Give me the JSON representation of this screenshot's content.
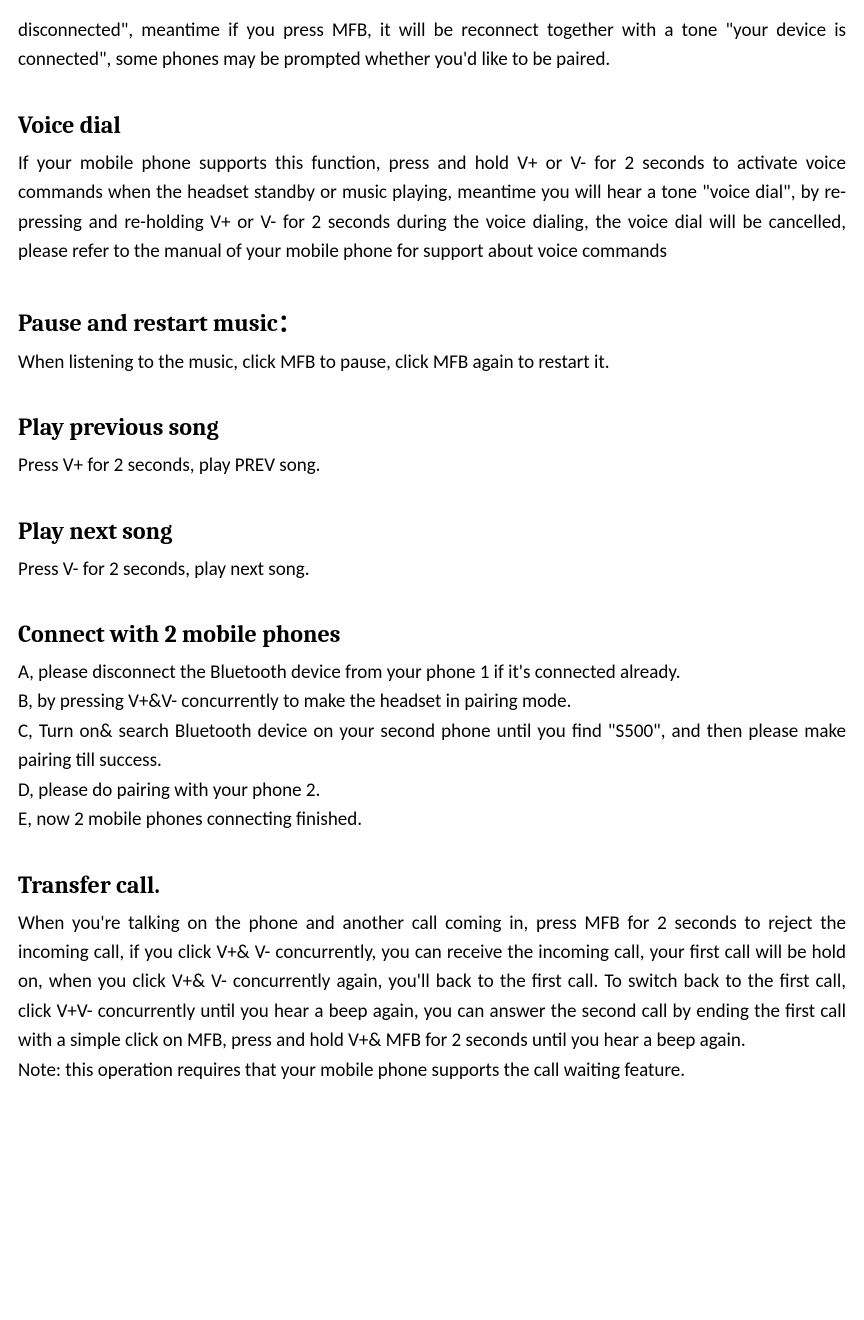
{
  "intro_para": "disconnected\", meantime if you press MFB, it will be reconnect together with a tone \"your device is connected\", some phones may be prompted whether you'd like to be paired.",
  "sections": {
    "voice_dial": {
      "heading": "Voice dial",
      "body": "If your mobile phone supports this function, press and hold V+ or V- for 2 seconds to activate voice commands when the headset standby or music playing, meantime you will hear a tone \"voice dial\", by re-pressing and re-holding V+ or V- for 2 seconds during the voice dialing, the voice dial will be cancelled, please refer to the manual of your mobile phone for support about voice commands"
    },
    "pause_restart": {
      "heading": "Pause and restart music：",
      "body": "When listening to the music, click MFB to pause, click MFB again to restart it."
    },
    "prev_song": {
      "heading": "Play previous song",
      "body": "Press V+ for 2 seconds, play PREV song."
    },
    "next_song": {
      "heading": "Play next song",
      "body": "Press V- for 2 seconds, play next song."
    },
    "connect_two": {
      "heading": "Connect with 2 mobile phones",
      "items": [
        "A, please disconnect the Bluetooth device from your phone 1 if it's connected already.",
        "B, by pressing V+&V- concurrently to make the headset in pairing mode.",
        "C, Turn on& search Bluetooth device on your second phone until you find \"S500\", and then please make pairing till success.",
        "D, please do pairing with your phone 2.",
        "E, now 2 mobile phones connecting finished."
      ]
    },
    "transfer_call": {
      "heading": "Transfer call.",
      "body": "When you're talking on the phone and another call coming in, press MFB for 2 seconds to reject the incoming call, if you click V+& V- concurrently, you can receive the incoming call, your first call will be hold on, when you click V+& V- concurrently again, you'll back to the first call. To switch back to the first call, click V+V- concurrently until you hear a beep again, you can answer the second call by ending the first call with a simple click on MFB, press and hold V+& MFB for 2 seconds until you hear a beep again.",
      "note": "Note: this operation requires that your mobile phone supports the call waiting feature."
    }
  }
}
